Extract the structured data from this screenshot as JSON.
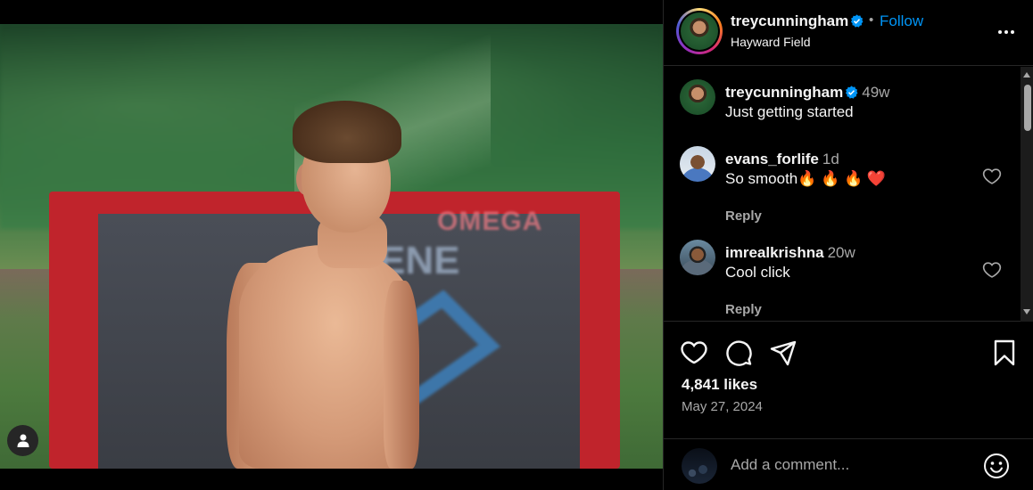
{
  "post": {
    "author": "treycunningham",
    "verified": true,
    "follow_label": "Follow",
    "dot": "•",
    "location": "Hayward Field",
    "likes": "4,841 likes",
    "date": "May 27, 2024"
  },
  "photo": {
    "board_text": "OMEGA",
    "board_letters": "ENE"
  },
  "comments": [
    {
      "username": "treycunningham",
      "time": "49w",
      "text": "Just getting started",
      "has_reply": false
    },
    {
      "username": "evans_forlife",
      "time": "1d",
      "text": "So smooth🔥 🔥 🔥 ❤️",
      "reply_label": "Reply",
      "has_reply": true
    },
    {
      "username": "imrealkrishna",
      "time": "20w",
      "text": "Cool click",
      "reply_label": "Reply",
      "has_reply": true
    }
  ],
  "add_comment": {
    "placeholder": "Add a comment..."
  },
  "colors": {
    "accent": "#0095f6",
    "verified": "#0095f6",
    "muted": "#a8a8a8",
    "board_red": "#c0242c"
  },
  "icons": {
    "like": "heart-icon",
    "comment": "speech-bubble-icon",
    "share": "paper-plane-icon",
    "save": "bookmark-icon",
    "more": "ellipsis-icon",
    "emoji": "smiley-icon",
    "user_tags": "person-icon"
  }
}
